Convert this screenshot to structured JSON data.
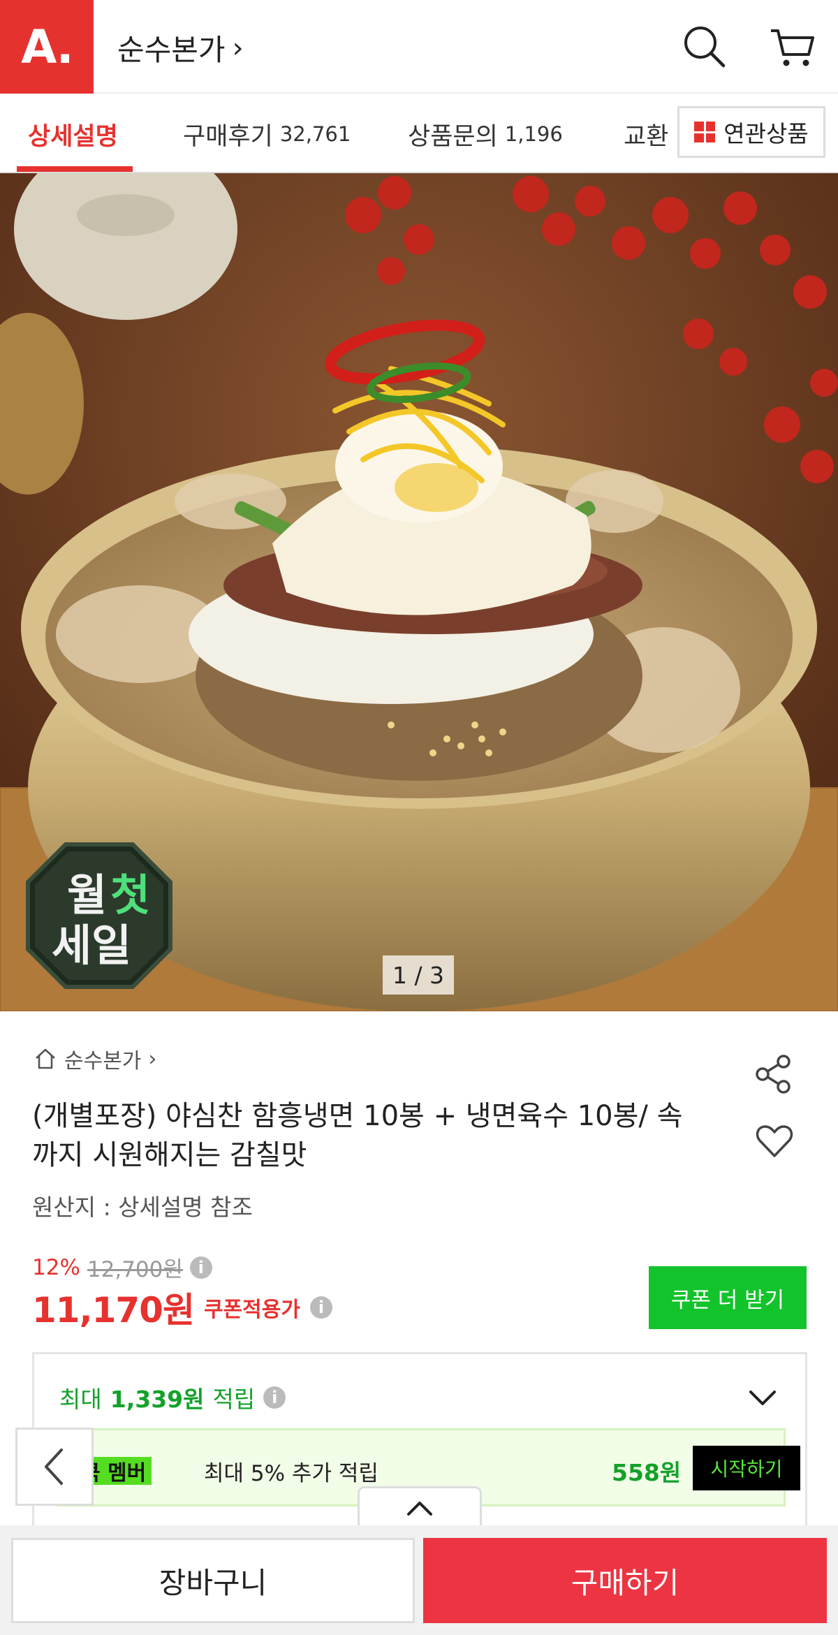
{
  "header": {
    "logo_text": "A.",
    "store_name": "순수본가",
    "store_chevron": "›",
    "icons": [
      "search-icon",
      "cart-icon"
    ]
  },
  "tabs": [
    {
      "label": "상세설명",
      "count": ""
    },
    {
      "label": "구매후기",
      "count": "32,761"
    },
    {
      "label": "상품문의",
      "count": "1,196"
    },
    {
      "label": "교환",
      "count": ""
    }
  ],
  "related_button": {
    "label": "연관상품",
    "icon": "grid-icon",
    "accent": "#e6322f"
  },
  "gallery": {
    "counter": "1 / 3",
    "badge_line1_a": "월",
    "badge_line1_b": "첫",
    "badge_line2": "세일"
  },
  "product": {
    "brand": "순수본가",
    "brand_chevron": "›",
    "title": "(개별포장) 야심찬 함흥냉면 10봉 + 냉면육수 10봉/ 속까지 시원해지는 감칠맛",
    "origin": "원산지 : 상세설명 참조",
    "discount_rate": "12%",
    "original_price": "12,700원",
    "price": "11,170원",
    "coupon_available": "쿠폰적용가",
    "coupon_button": "쿠폰 더 받기"
  },
  "reward": {
    "prefix": "최대",
    "amount": "1,339원",
    "suffix": "적립",
    "member_badge": "스마일캐시 멤버",
    "member_badge_visible": "쿡 멤버",
    "member_text": "최대 5% 추가 적립",
    "member_amount": "558원",
    "start_button": "시작하기"
  },
  "bottom": {
    "cart_label": "장바구니",
    "buy_label": "구매하기"
  },
  "colors": {
    "brand_red": "#e6322f",
    "green": "#13c32b",
    "buy_red": "#ec3442"
  }
}
